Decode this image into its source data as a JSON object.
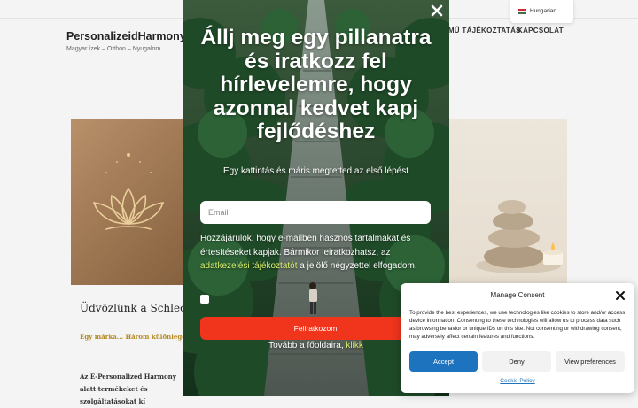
{
  "site": {
    "logo": "PersonalizeidHarmony",
    "tagline": "Magyar ízek – Otthon – Nyugalom",
    "nav": [
      {
        "label": "ELMŰ TÁJÉKOZTATÁS"
      },
      {
        "label": "KAPCSOLAT"
      }
    ]
  },
  "language": {
    "label": "Hungarian",
    "flag_colors": [
      "#cd2a3e",
      "#ffffff",
      "#436f4d"
    ]
  },
  "post": {
    "title": "Üdvözlünk a Schleck & Ha",
    "meta": "Egy márka... Három különleges él",
    "text": "Az E-Personalized Harmony alatt termékeket és szolgáltatásokat kí"
  },
  "popup": {
    "headline": "Állj meg egy pillanatra és iratkozz fel hírlevelemre, hogy azonnal kedvet kapj fejlődéshez",
    "subtitle": "Egy kattintás és máris megtetted az első lépést",
    "email_placeholder": "Email",
    "consent_before": "Hozzájárulok, hogy e-mailben hasznos tartalmakat és értesítéseket kapjak. Bármikor leiratkozhatsz, az ",
    "consent_link": "adatkezelési tájékoztatót",
    "consent_after": " a jelölő négyzettel elfogadom.",
    "subscribe_label": "Feliratkozom",
    "continue_before": "Tovább a főoldaira, ",
    "continue_link": "klikk",
    "close_icon": "close-icon",
    "link_color": "#d9ef6a",
    "button_color": "#f0351c"
  },
  "cookie_consent": {
    "title": "Manage Consent",
    "text": "To provide the best experiences, we use technologies like cookies to store and/or access device information. Consenting to these technologies will allow us to process data such as browsing behavior or unique IDs on this site. Not consenting or withdrawing consent, may adversely affect certain features and functions.",
    "accept_label": "Accept",
    "deny_label": "Deny",
    "preferences_label": "View preferences",
    "policy_link": "Cookie Policy",
    "accent_color": "#1e73be"
  }
}
